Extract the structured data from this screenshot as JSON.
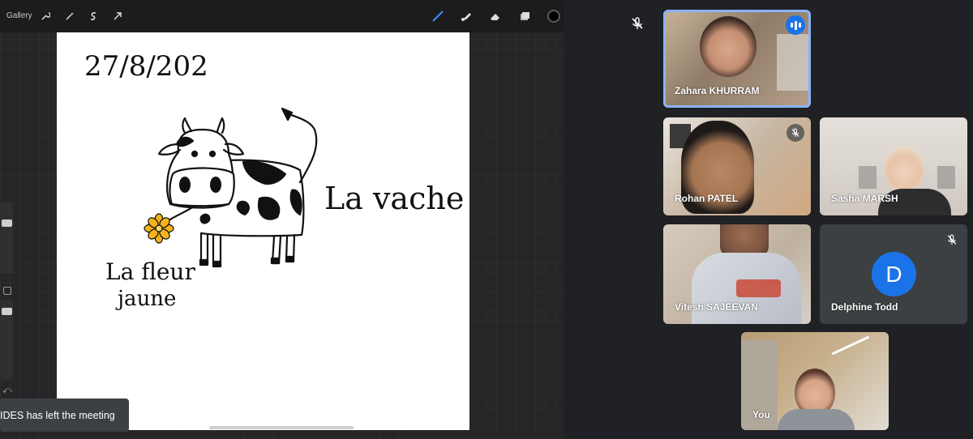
{
  "app": {
    "gallery_label": "Gallery",
    "toast_text": "IDES has left the meeting"
  },
  "canvas": {
    "date_text": "27/8/202",
    "label_cow": "La vache",
    "label_flower_line1": "La fleur",
    "label_flower_line2": "jaune"
  },
  "participants": [
    {
      "name": "Zahara KHURRAM",
      "speaking": true,
      "muted": false
    },
    {
      "name": "Rohan PATEL",
      "speaking": false,
      "muted": true
    },
    {
      "name": "Sasha MARSH",
      "speaking": false,
      "muted": false
    },
    {
      "name": "Vitesh SAJEEVAN",
      "speaking": false,
      "muted": false
    },
    {
      "name": "Delphine Todd",
      "speaking": false,
      "muted": true,
      "avatar_letter": "D"
    },
    {
      "name": "You",
      "speaking": false,
      "muted": false
    }
  ],
  "colors": {
    "meet_bg": "#202124",
    "speaking_ring": "#8ab4f8",
    "avatar_blue": "#1a73e8",
    "flower_yellow": "#f5b31c"
  },
  "icons": {
    "toolbar": [
      "wrench-icon",
      "magic-wand-icon",
      "selection-icon",
      "transform-arrow-icon",
      "brush-icon",
      "smudge-icon",
      "eraser-icon",
      "layers-icon",
      "color-picker-icon"
    ],
    "meet": [
      "mic-off-icon",
      "speaking-indicator-icon"
    ]
  }
}
